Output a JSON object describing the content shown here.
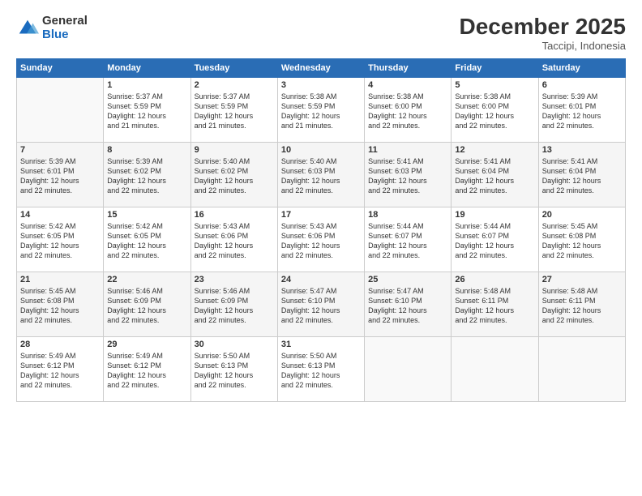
{
  "logo": {
    "general": "General",
    "blue": "Blue"
  },
  "title": "December 2025",
  "location": "Taccipi, Indonesia",
  "days_of_week": [
    "Sunday",
    "Monday",
    "Tuesday",
    "Wednesday",
    "Thursday",
    "Friday",
    "Saturday"
  ],
  "weeks": [
    [
      {
        "day": "",
        "text": ""
      },
      {
        "day": "1",
        "text": "Sunrise: 5:37 AM\nSunset: 5:59 PM\nDaylight: 12 hours\nand 21 minutes."
      },
      {
        "day": "2",
        "text": "Sunrise: 5:37 AM\nSunset: 5:59 PM\nDaylight: 12 hours\nand 21 minutes."
      },
      {
        "day": "3",
        "text": "Sunrise: 5:38 AM\nSunset: 5:59 PM\nDaylight: 12 hours\nand 21 minutes."
      },
      {
        "day": "4",
        "text": "Sunrise: 5:38 AM\nSunset: 6:00 PM\nDaylight: 12 hours\nand 22 minutes."
      },
      {
        "day": "5",
        "text": "Sunrise: 5:38 AM\nSunset: 6:00 PM\nDaylight: 12 hours\nand 22 minutes."
      },
      {
        "day": "6",
        "text": "Sunrise: 5:39 AM\nSunset: 6:01 PM\nDaylight: 12 hours\nand 22 minutes."
      }
    ],
    [
      {
        "day": "7",
        "text": "Sunrise: 5:39 AM\nSunset: 6:01 PM\nDaylight: 12 hours\nand 22 minutes."
      },
      {
        "day": "8",
        "text": "Sunrise: 5:39 AM\nSunset: 6:02 PM\nDaylight: 12 hours\nand 22 minutes."
      },
      {
        "day": "9",
        "text": "Sunrise: 5:40 AM\nSunset: 6:02 PM\nDaylight: 12 hours\nand 22 minutes."
      },
      {
        "day": "10",
        "text": "Sunrise: 5:40 AM\nSunset: 6:03 PM\nDaylight: 12 hours\nand 22 minutes."
      },
      {
        "day": "11",
        "text": "Sunrise: 5:41 AM\nSunset: 6:03 PM\nDaylight: 12 hours\nand 22 minutes."
      },
      {
        "day": "12",
        "text": "Sunrise: 5:41 AM\nSunset: 6:04 PM\nDaylight: 12 hours\nand 22 minutes."
      },
      {
        "day": "13",
        "text": "Sunrise: 5:41 AM\nSunset: 6:04 PM\nDaylight: 12 hours\nand 22 minutes."
      }
    ],
    [
      {
        "day": "14",
        "text": "Sunrise: 5:42 AM\nSunset: 6:05 PM\nDaylight: 12 hours\nand 22 minutes."
      },
      {
        "day": "15",
        "text": "Sunrise: 5:42 AM\nSunset: 6:05 PM\nDaylight: 12 hours\nand 22 minutes."
      },
      {
        "day": "16",
        "text": "Sunrise: 5:43 AM\nSunset: 6:06 PM\nDaylight: 12 hours\nand 22 minutes."
      },
      {
        "day": "17",
        "text": "Sunrise: 5:43 AM\nSunset: 6:06 PM\nDaylight: 12 hours\nand 22 minutes."
      },
      {
        "day": "18",
        "text": "Sunrise: 5:44 AM\nSunset: 6:07 PM\nDaylight: 12 hours\nand 22 minutes."
      },
      {
        "day": "19",
        "text": "Sunrise: 5:44 AM\nSunset: 6:07 PM\nDaylight: 12 hours\nand 22 minutes."
      },
      {
        "day": "20",
        "text": "Sunrise: 5:45 AM\nSunset: 6:08 PM\nDaylight: 12 hours\nand 22 minutes."
      }
    ],
    [
      {
        "day": "21",
        "text": "Sunrise: 5:45 AM\nSunset: 6:08 PM\nDaylight: 12 hours\nand 22 minutes."
      },
      {
        "day": "22",
        "text": "Sunrise: 5:46 AM\nSunset: 6:09 PM\nDaylight: 12 hours\nand 22 minutes."
      },
      {
        "day": "23",
        "text": "Sunrise: 5:46 AM\nSunset: 6:09 PM\nDaylight: 12 hours\nand 22 minutes."
      },
      {
        "day": "24",
        "text": "Sunrise: 5:47 AM\nSunset: 6:10 PM\nDaylight: 12 hours\nand 22 minutes."
      },
      {
        "day": "25",
        "text": "Sunrise: 5:47 AM\nSunset: 6:10 PM\nDaylight: 12 hours\nand 22 minutes."
      },
      {
        "day": "26",
        "text": "Sunrise: 5:48 AM\nSunset: 6:11 PM\nDaylight: 12 hours\nand 22 minutes."
      },
      {
        "day": "27",
        "text": "Sunrise: 5:48 AM\nSunset: 6:11 PM\nDaylight: 12 hours\nand 22 minutes."
      }
    ],
    [
      {
        "day": "28",
        "text": "Sunrise: 5:49 AM\nSunset: 6:12 PM\nDaylight: 12 hours\nand 22 minutes."
      },
      {
        "day": "29",
        "text": "Sunrise: 5:49 AM\nSunset: 6:12 PM\nDaylight: 12 hours\nand 22 minutes."
      },
      {
        "day": "30",
        "text": "Sunrise: 5:50 AM\nSunset: 6:13 PM\nDaylight: 12 hours\nand 22 minutes."
      },
      {
        "day": "31",
        "text": "Sunrise: 5:50 AM\nSunset: 6:13 PM\nDaylight: 12 hours\nand 22 minutes."
      },
      {
        "day": "",
        "text": ""
      },
      {
        "day": "",
        "text": ""
      },
      {
        "day": "",
        "text": ""
      }
    ]
  ]
}
